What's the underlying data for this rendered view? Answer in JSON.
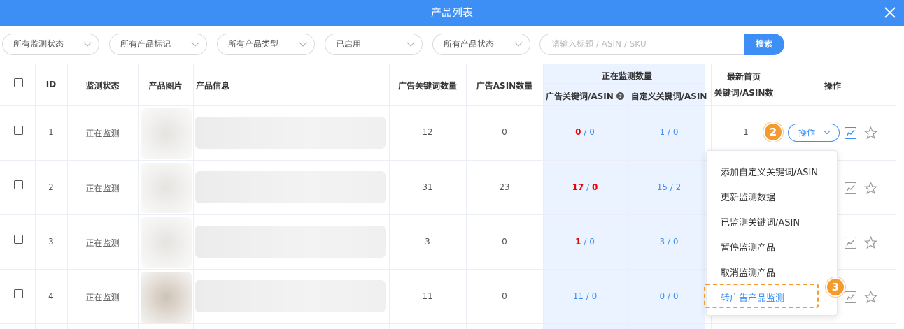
{
  "window": {
    "title": "产品列表"
  },
  "filters": {
    "selects": [
      {
        "label": "所有监测状态"
      },
      {
        "label": "所有产品标记"
      },
      {
        "label": "所有产品类型"
      },
      {
        "label": "已启用"
      },
      {
        "label": "所有产品状态"
      }
    ],
    "search_placeholder": "请输入标题 / ASIN / SKU",
    "search_button": "搜索"
  },
  "table": {
    "headers": {
      "id": "ID",
      "monitor_status": "监测状态",
      "product_image": "产品图片",
      "product_info": "产品信息",
      "ad_keyword_count": "广告关键词数量",
      "ad_asin_count": "广告ASIN数量",
      "monitoring_count": "正在监测数量",
      "ad_kw_asin": "广告关键词/ASIN",
      "custom_kw_asin": "自定义关键词/ASIN",
      "latest_top_line1": "最新首页",
      "latest_top_line2": "关键词/ASIN数",
      "actions": "操作"
    },
    "rows": [
      {
        "id": "1",
        "status": "正在监测",
        "ad_kw": "12",
        "ad_asin": "0",
        "mon_a": "0",
        "mon_b": "0",
        "cus_a": "1",
        "cus_b": "0",
        "latest": "1"
      },
      {
        "id": "2",
        "status": "正在监测",
        "ad_kw": "31",
        "ad_asin": "23",
        "mon_a": "17",
        "mon_b": "0",
        "cus_a": "15",
        "cus_b": "2",
        "latest": ""
      },
      {
        "id": "3",
        "status": "正在监测",
        "ad_kw": "3",
        "ad_asin": "0",
        "mon_a": "1",
        "mon_b": "0",
        "cus_a": "3",
        "cus_b": "0",
        "latest": ""
      },
      {
        "id": "4",
        "status": "正在监测",
        "ad_kw": "11",
        "ad_asin": "0",
        "mon_a": "11",
        "mon_b": "0",
        "cus_a": "0",
        "cus_b": "0",
        "latest": ""
      }
    ],
    "slash": " / ",
    "ops_button": "操作"
  },
  "menu": {
    "items": [
      {
        "label": "添加自定义关键词/ASIN"
      },
      {
        "label": "更新监测数据"
      },
      {
        "label": "已监测关键词/ASIN"
      },
      {
        "label": "暂停监测产品"
      },
      {
        "label": "取消监测产品"
      },
      {
        "label": "转广告产品监测"
      }
    ]
  },
  "annotations": {
    "step2": "2",
    "step3": "3"
  },
  "colors": {
    "accent": "#3d8ff5",
    "highlight": "#f39b2e",
    "alert": "#ee0000"
  }
}
